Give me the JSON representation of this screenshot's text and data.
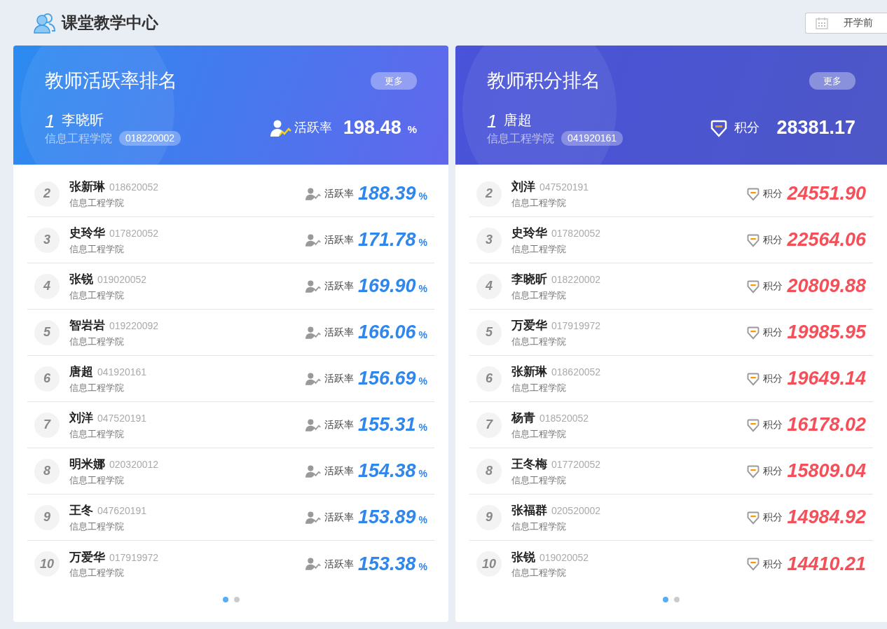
{
  "page_title": "课堂教学中心",
  "term_selector": {
    "label": "开学前"
  },
  "panels": [
    {
      "kind": "activity",
      "title": "教师活跃率排名",
      "more_button": "更多",
      "leader": {
        "rank": "1",
        "name": "李晓昕",
        "department": "信息工程学院",
        "id": "018220002",
        "metric_label": "活跃率",
        "value": "198.48",
        "unit": "%"
      },
      "rows": [
        {
          "rank": "2",
          "name": "张新琳",
          "id": "018620052",
          "department": "信息工程学院",
          "metric_label": "活跃率",
          "value": "188.39",
          "unit": "%"
        },
        {
          "rank": "3",
          "name": "史玲华",
          "id": "017820052",
          "department": "信息工程学院",
          "metric_label": "活跃率",
          "value": "171.78",
          "unit": "%"
        },
        {
          "rank": "4",
          "name": "张锐",
          "id": "019020052",
          "department": "信息工程学院",
          "metric_label": "活跃率",
          "value": "169.90",
          "unit": "%"
        },
        {
          "rank": "5",
          "name": "智岩岩",
          "id": "019220092",
          "department": "信息工程学院",
          "metric_label": "活跃率",
          "value": "166.06",
          "unit": "%"
        },
        {
          "rank": "6",
          "name": "唐超",
          "id": "041920161",
          "department": "信息工程学院",
          "metric_label": "活跃率",
          "value": "156.69",
          "unit": "%"
        },
        {
          "rank": "7",
          "name": "刘洋",
          "id": "047520191",
          "department": "信息工程学院",
          "metric_label": "活跃率",
          "value": "155.31",
          "unit": "%"
        },
        {
          "rank": "8",
          "name": "明米娜",
          "id": "020320012",
          "department": "信息工程学院",
          "metric_label": "活跃率",
          "value": "154.38",
          "unit": "%"
        },
        {
          "rank": "9",
          "name": "王冬",
          "id": "047620191",
          "department": "信息工程学院",
          "metric_label": "活跃率",
          "value": "153.89",
          "unit": "%"
        },
        {
          "rank": "10",
          "name": "万爱华",
          "id": "017919972",
          "department": "信息工程学院",
          "metric_label": "活跃率",
          "value": "153.38",
          "unit": "%"
        }
      ],
      "pager": [
        {
          "selected": true
        },
        {
          "selected": false
        }
      ]
    },
    {
      "kind": "points",
      "title": "教师积分排名",
      "more_button": "更多",
      "leader": {
        "rank": "1",
        "name": "唐超",
        "department": "信息工程学院",
        "id": "041920161",
        "metric_label": "积分",
        "value": "28381.17"
      },
      "rows": [
        {
          "rank": "2",
          "name": "刘洋",
          "id": "047520191",
          "department": "信息工程学院",
          "metric_label": "积分",
          "value": "24551.90"
        },
        {
          "rank": "3",
          "name": "史玲华",
          "id": "017820052",
          "department": "信息工程学院",
          "metric_label": "积分",
          "value": "22564.06"
        },
        {
          "rank": "4",
          "name": "李晓昕",
          "id": "018220002",
          "department": "信息工程学院",
          "metric_label": "积分",
          "value": "20809.88"
        },
        {
          "rank": "5",
          "name": "万爱华",
          "id": "017919972",
          "department": "信息工程学院",
          "metric_label": "积分",
          "value": "19985.95"
        },
        {
          "rank": "6",
          "name": "张新琳",
          "id": "018620052",
          "department": "信息工程学院",
          "metric_label": "积分",
          "value": "19649.14"
        },
        {
          "rank": "7",
          "name": "杨青",
          "id": "018520052",
          "department": "信息工程学院",
          "metric_label": "积分",
          "value": "16178.02"
        },
        {
          "rank": "8",
          "name": "王冬梅",
          "id": "017720052",
          "department": "信息工程学院",
          "metric_label": "积分",
          "value": "15809.04"
        },
        {
          "rank": "9",
          "name": "张福群",
          "id": "020520002",
          "department": "信息工程学院",
          "metric_label": "积分",
          "value": "14984.92"
        },
        {
          "rank": "10",
          "name": "张锐",
          "id": "019020052",
          "department": "信息工程学院",
          "metric_label": "积分",
          "value": "14410.21"
        }
      ],
      "pager": [
        {
          "selected": true
        },
        {
          "selected": false
        }
      ]
    }
  ]
}
